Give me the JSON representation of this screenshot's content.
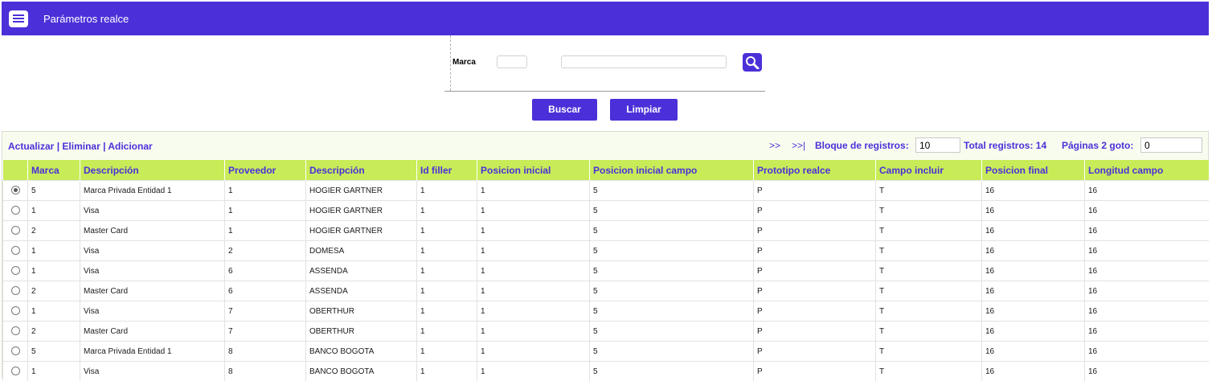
{
  "header": {
    "title": "Parámetros realce",
    "icon": "menu-list-icon"
  },
  "filter": {
    "marca_label": "Marca",
    "marca_code_value": "",
    "marca_desc_value": "",
    "search_icon": "search-icon"
  },
  "buttons": {
    "buscar": "Buscar",
    "limpiar": "Limpiar"
  },
  "actions": {
    "actualizar": "Actualizar",
    "sep1": " | ",
    "eliminar": "Eliminar",
    "sep2": " | ",
    "adicionar": "Adicionar"
  },
  "pager": {
    "next": ">>",
    "last": ">>|",
    "bloque_label": "Bloque de registros:",
    "bloque_value": "10",
    "total_label": "Total registros: 14",
    "paginas_label": "Páginas 2 goto:",
    "goto_value": "0"
  },
  "colors": {
    "primary": "#4b30d9",
    "header_row": "#c8ec58",
    "panel_bg": "#f8fcef"
  },
  "table": {
    "columns": [
      "",
      "Marca",
      "Descripción",
      "Proveedor",
      "Descripción",
      "Id filler",
      "Posicion inicial",
      "Posicion inicial campo",
      "Prototipo realce",
      "Campo incluir",
      "Posicion final",
      "Longitud campo"
    ],
    "rows": [
      {
        "selected": true,
        "cells": [
          "5",
          "Marca Privada Entidad 1",
          "1",
          "HOGIER GARTNER",
          "1",
          "1",
          "5",
          "P",
          "T",
          "16",
          "16"
        ]
      },
      {
        "selected": false,
        "cells": [
          "1",
          "Visa",
          "1",
          "HOGIER GARTNER",
          "1",
          "1",
          "5",
          "P",
          "T",
          "16",
          "16"
        ]
      },
      {
        "selected": false,
        "cells": [
          "2",
          "Master Card",
          "1",
          "HOGIER GARTNER",
          "1",
          "1",
          "5",
          "P",
          "T",
          "16",
          "16"
        ]
      },
      {
        "selected": false,
        "cells": [
          "1",
          "Visa",
          "2",
          "DOMESA",
          "1",
          "1",
          "5",
          "P",
          "T",
          "16",
          "16"
        ]
      },
      {
        "selected": false,
        "cells": [
          "1",
          "Visa",
          "6",
          "ASSENDA",
          "1",
          "1",
          "5",
          "P",
          "T",
          "16",
          "16"
        ]
      },
      {
        "selected": false,
        "cells": [
          "2",
          "Master Card",
          "6",
          "ASSENDA",
          "1",
          "1",
          "5",
          "P",
          "T",
          "16",
          "16"
        ]
      },
      {
        "selected": false,
        "cells": [
          "1",
          "Visa",
          "7",
          "OBERTHUR",
          "1",
          "1",
          "5",
          "P",
          "T",
          "16",
          "16"
        ]
      },
      {
        "selected": false,
        "cells": [
          "2",
          "Master Card",
          "7",
          "OBERTHUR",
          "1",
          "1",
          "5",
          "P",
          "T",
          "16",
          "16"
        ]
      },
      {
        "selected": false,
        "cells": [
          "5",
          "Marca Privada Entidad 1",
          "8",
          "BANCO BOGOTA",
          "1",
          "1",
          "5",
          "P",
          "T",
          "16",
          "16"
        ]
      },
      {
        "selected": false,
        "cells": [
          "1",
          "Visa",
          "8",
          "BANCO BOGOTA",
          "1",
          "1",
          "5",
          "P",
          "T",
          "16",
          "16"
        ]
      }
    ]
  }
}
